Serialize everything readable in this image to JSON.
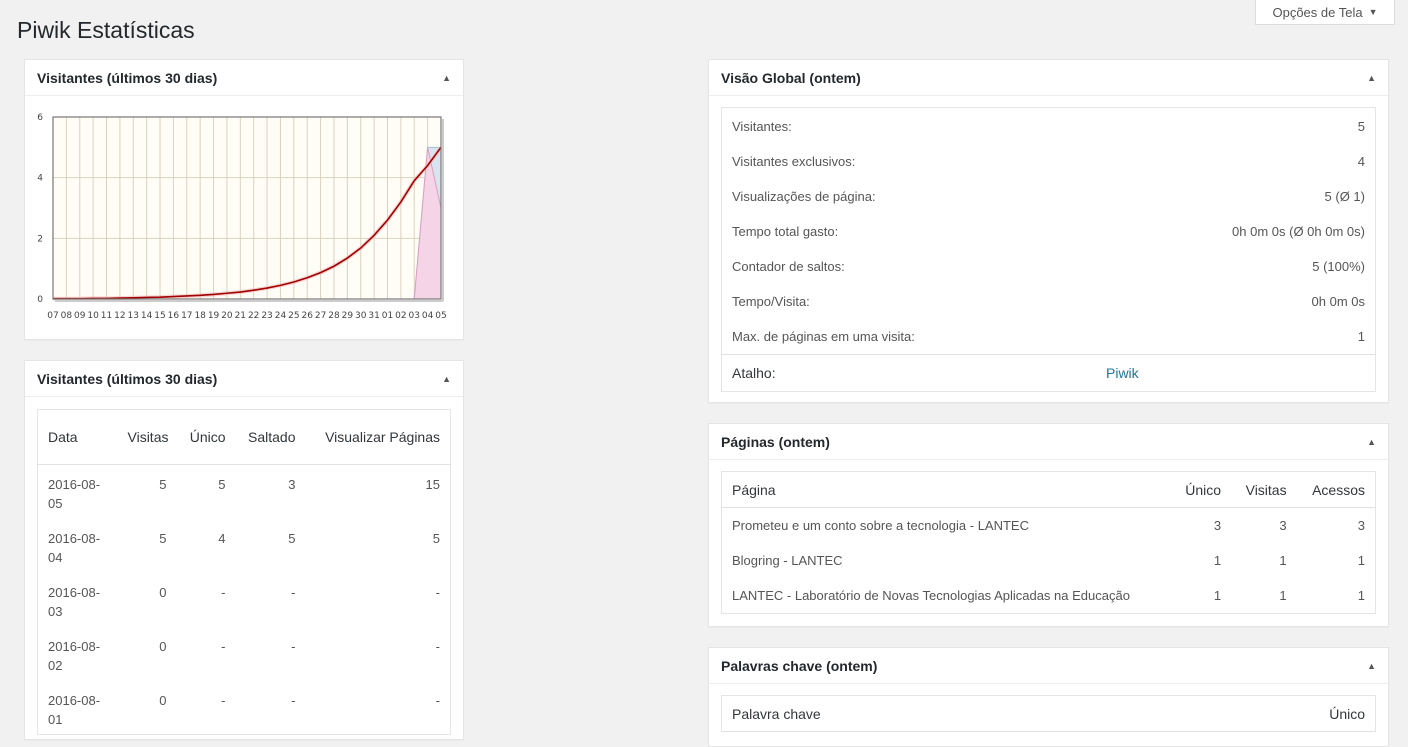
{
  "page": {
    "title": "Piwik Estatísticas",
    "screen_options": "Opções de Tela"
  },
  "widgets": {
    "visitors_chart": {
      "title": "Visitantes (últimos 30 dias)"
    },
    "visitors_table": {
      "title": "Visitantes (últimos 30 dias)",
      "headers": [
        "Data",
        "Visitas",
        "Único",
        "Saltado",
        "Visualizar Páginas"
      ],
      "rows": [
        [
          "2016-08-05",
          "5",
          "5",
          "3",
          "15"
        ],
        [
          "2016-08-04",
          "5",
          "4",
          "5",
          "5"
        ],
        [
          "2016-08-03",
          "0",
          "-",
          "-",
          "-"
        ],
        [
          "2016-08-02",
          "0",
          "-",
          "-",
          "-"
        ],
        [
          "2016-08-01",
          "0",
          "-",
          "-",
          "-"
        ]
      ]
    },
    "overview": {
      "title": "Visão Global (ontem)",
      "rows": [
        {
          "label": "Visitantes:",
          "value": "5"
        },
        {
          "label": "Visitantes exclusivos:",
          "value": "4"
        },
        {
          "label": "Visualizações de página:",
          "value": "5 (Ø 1)"
        },
        {
          "label": "Tempo total gasto:",
          "value": "0h 0m 0s (Ø 0h 0m 0s)"
        },
        {
          "label": "Contador de saltos:",
          "value": "5 (100%)"
        },
        {
          "label": "Tempo/Visita:",
          "value": "0h 0m 0s"
        },
        {
          "label": "Max. de páginas em uma visita:",
          "value": "1"
        }
      ],
      "shortcut_label": "Atalho:",
      "shortcut_link": "Piwik"
    },
    "pages": {
      "title": "Páginas (ontem)",
      "headers": [
        "Página",
        "Único",
        "Visitas",
        "Acessos"
      ],
      "rows": [
        [
          "Prometeu e um conto sobre a tecnologia - LANTEC",
          "3",
          "3",
          "3"
        ],
        [
          "Blogring - LANTEC",
          "1",
          "1",
          "1"
        ],
        [
          "LANTEC - Laboratório de Novas Tecnologias Aplicadas na Educação",
          "1",
          "1",
          "1"
        ]
      ]
    },
    "keywords": {
      "title": "Palavras chave (ontem)",
      "headers": [
        "Palavra chave",
        "Único"
      ]
    }
  },
  "chart_data": {
    "type": "line",
    "title": "",
    "categories": [
      "07",
      "08",
      "09",
      "10",
      "11",
      "12",
      "13",
      "14",
      "15",
      "16",
      "17",
      "18",
      "19",
      "20",
      "21",
      "22",
      "23",
      "24",
      "25",
      "26",
      "27",
      "28",
      "29",
      "30",
      "31",
      "01",
      "02",
      "03",
      "04",
      "05"
    ],
    "series": [
      {
        "values": [
          0,
          0,
          0,
          0,
          0,
          0,
          0,
          0,
          0,
          0,
          0,
          0,
          0,
          0,
          0,
          0,
          0,
          0,
          0,
          0,
          0,
          0,
          0,
          0,
          0,
          0,
          0,
          0,
          5,
          5
        ]
      },
      {
        "values": [
          0,
          0,
          0,
          0,
          0,
          0,
          0,
          0,
          0,
          0,
          0,
          0,
          0,
          0,
          0,
          0,
          0,
          0,
          0,
          0,
          0,
          0,
          0,
          0,
          0,
          0,
          0,
          0,
          5,
          3
        ]
      },
      {
        "values": [
          0.01,
          0.01,
          0.01,
          0.02,
          0.02,
          0.03,
          0.04,
          0.05,
          0.06,
          0.08,
          0.1,
          0.12,
          0.15,
          0.19,
          0.23,
          0.29,
          0.36,
          0.45,
          0.56,
          0.7,
          0.87,
          1.08,
          1.35,
          1.68,
          2.1,
          2.6,
          3.2,
          3.9,
          4.4,
          5
        ]
      }
    ],
    "yticks": [
      0,
      2,
      4,
      6
    ],
    "ylim": [
      0,
      6
    ],
    "grid": true,
    "colors": {
      "trend": "#a00000",
      "pink_area": "#f4d4e6",
      "blue_area": "#d8e4ef",
      "plot_bg": "#fffdf6",
      "grid": "#d9d2c0"
    }
  }
}
